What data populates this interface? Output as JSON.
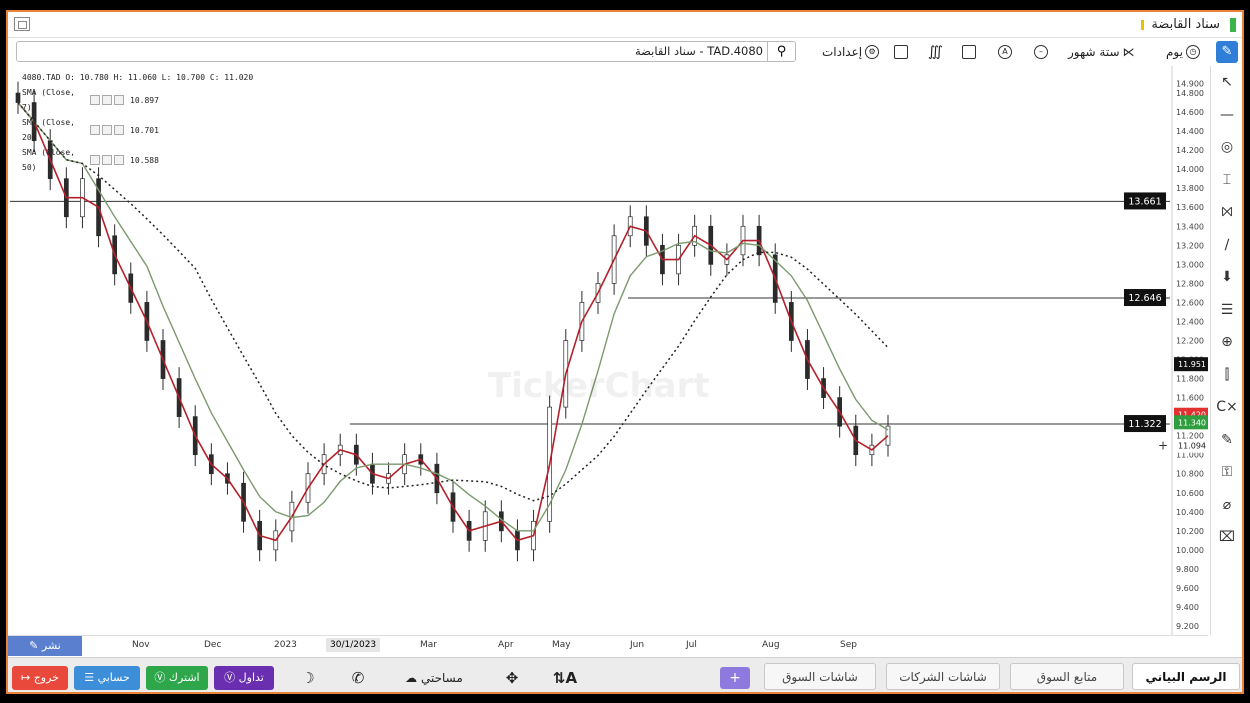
{
  "window": {
    "title": "سناد القابضة"
  },
  "toolbar": {
    "search_value": "TAD.4080 - سناد القابضة",
    "settings_label": "إعدادات",
    "range_label": "ستة شهور",
    "interval_label": "يوم"
  },
  "legend": {
    "ohlc": "4080.TAD  O: 10.780  H: 11.060  L: 10.700  C: 11.020",
    "sma7": {
      "label": "SMA (Close, 7)",
      "value": "10.897"
    },
    "sma20": {
      "label": "SMA (Close, 20)",
      "value": "10.701"
    },
    "sma50": {
      "label": "SMA (Close, 50)",
      "value": "10.588"
    }
  },
  "watermark": "TickerChart",
  "chart_data": {
    "type": "candlestick",
    "y_axis_ticks": [
      "14.900",
      "14.800",
      "14.600",
      "14.400",
      "14.200",
      "14.000",
      "13.800",
      "13.600",
      "13.400",
      "13.200",
      "13.000",
      "12.800",
      "12.600",
      "12.400",
      "12.200",
      "12.000",
      "11.800",
      "11.600",
      "11.400",
      "11.200",
      "11.000",
      "10.800",
      "10.600",
      "10.400",
      "10.200",
      "10.000",
      "9.800",
      "9.600",
      "9.400",
      "9.200"
    ],
    "ylim": [
      9.2,
      15.0
    ],
    "x_tick_labels": [
      "Nov",
      "Dec",
      "2023",
      "Mar",
      "Apr",
      "May",
      "Jun",
      "Jul",
      "Aug",
      "Sep"
    ],
    "cursor_date": "30/1/2023",
    "horizontal_lines": [
      {
        "value": 13.661,
        "label": "13.661"
      },
      {
        "value": 12.646,
        "label": "12.646"
      },
      {
        "value": 11.322,
        "label": "11.322"
      }
    ],
    "price_labels": [
      {
        "value": 11.951,
        "label": "11.951",
        "color": "#111111"
      },
      {
        "value": 11.42,
        "label": "11.420",
        "color": "#e0302f"
      },
      {
        "value": 11.34,
        "label": "11.340",
        "color": "#2e9e3e"
      },
      {
        "value": 11.094,
        "label": "11.094",
        "color": "#ffffff"
      }
    ],
    "close_series": [
      14.7,
      14.3,
      13.9,
      13.5,
      13.9,
      13.3,
      12.9,
      12.6,
      12.2,
      11.8,
      11.4,
      11.0,
      10.8,
      10.7,
      10.3,
      10.0,
      10.2,
      10.5,
      10.8,
      11.0,
      11.1,
      10.9,
      10.7,
      10.8,
      11.0,
      10.9,
      10.6,
      10.3,
      10.1,
      10.4,
      10.2,
      10.0,
      10.3,
      11.5,
      12.2,
      12.6,
      12.8,
      13.3,
      13.5,
      13.2,
      12.9,
      13.2,
      13.4,
      13.0,
      13.1,
      13.4,
      13.1,
      12.6,
      12.2,
      11.8,
      11.6,
      11.3,
      11.0,
      11.1,
      11.3
    ]
  },
  "tools": [
    "cursor-icon",
    "line-icon",
    "circle-icon",
    "text-icon",
    "pattern-icon",
    "fib-icon",
    "arrow-icon",
    "list-icon",
    "zoom-icon",
    "indicator-icon",
    "clear-icon",
    "brush-icon",
    "lock-icon",
    "hide-icon",
    "trash-icon"
  ],
  "timebar": {
    "publish_label": "نشر"
  },
  "bottombar": {
    "logout_label": "خروج",
    "account_label": "حسابي",
    "subscribe_label": "اشترك",
    "trade_label": "تداول",
    "workspace_label": "مساحتي",
    "font_label": "A",
    "tabs": [
      "الرسم البياني",
      "متابع السوق",
      "شاشات الشركات",
      "شاشات السوق"
    ],
    "plus_label": "+"
  }
}
